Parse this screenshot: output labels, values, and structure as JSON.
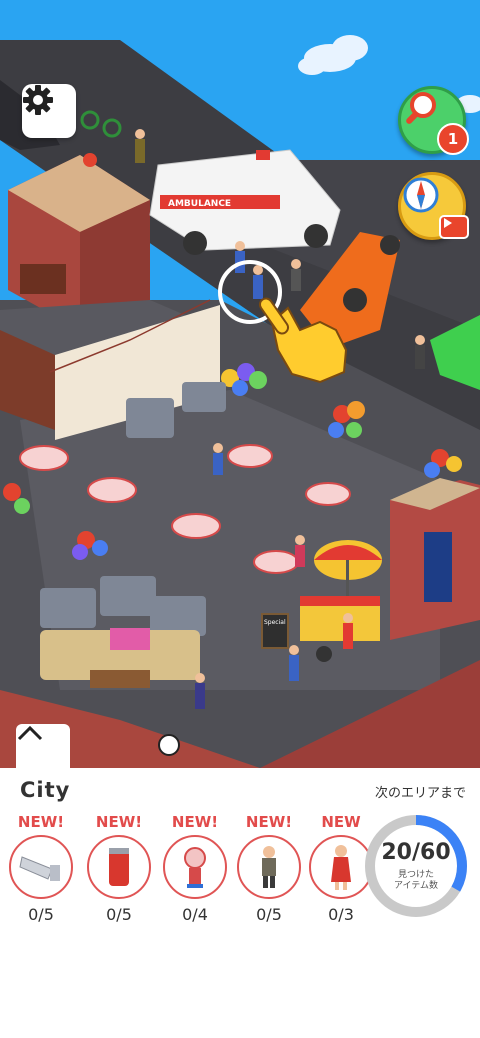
{
  "hud": {
    "settings_icon": "gear-icon",
    "hint_icon": "magnifier-icon",
    "hint_badge": "1",
    "compass_icon": "compass-icon",
    "video_icon": "video-play-icon"
  },
  "scene": {
    "ambulance_text": "AMBULANCE",
    "sign_text": "Special"
  },
  "panel": {
    "area_title": "City",
    "next_area_label": "次のエリアまで",
    "progress": {
      "found": 20,
      "total": 60,
      "text": "20/60",
      "caption_line1": "見つけた",
      "caption_line2": "アイテム数"
    },
    "items": [
      {
        "new_label": "NEW!",
        "count": "0/5",
        "icon": "cctv-camera-icon"
      },
      {
        "new_label": "NEW!",
        "count": "0/5",
        "icon": "soda-can-icon"
      },
      {
        "new_label": "NEW!",
        "count": "0/4",
        "icon": "gumball-machine-icon"
      },
      {
        "new_label": "NEW!",
        "count": "0/5",
        "icon": "old-man-icon"
      },
      {
        "new_label": "NEW",
        "count": "0/3",
        "icon": "woman-red-dress-icon"
      }
    ]
  },
  "colors": {
    "sky": "#2aa4f2",
    "accent_red": "#e24b4b",
    "progress_blue": "#3b82f6",
    "progress_track": "#c9c9c9"
  }
}
